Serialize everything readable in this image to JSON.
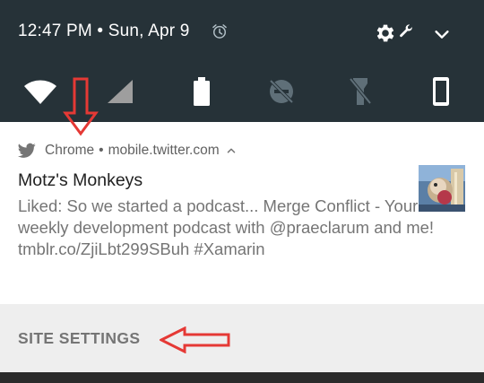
{
  "status_bar": {
    "time": "12:47 PM",
    "separator": "•",
    "date": "Sun, Apr 9",
    "icons": [
      "alarm-icon",
      "settings-gear-icon",
      "wrench-icon",
      "expand-chevron-icon"
    ]
  },
  "quick_settings": {
    "tiles": [
      "wifi-icon",
      "cellular-signal-icon",
      "battery-icon",
      "do-not-disturb-off-icon",
      "flashlight-off-icon",
      "phone-screen-icon"
    ]
  },
  "notification": {
    "app_icon": "twitter-icon",
    "app_name": "Chrome",
    "header_separator": "•",
    "source": "mobile.twitter.com",
    "title": "Motz's Monkeys",
    "body": "Liked: So we started a podcast... Merge Conflict - Your weekly development podcast with @praeclarum and me! tmblr.co/ZjiLbt299SBuh #Xamarin",
    "thumbnail": "avatar-thumbnail"
  },
  "actions": {
    "site_settings": "SITE SETTINGS"
  },
  "colors": {
    "shade": "#263238",
    "card": "#ffffff",
    "action_bar": "#eeeeee",
    "annotation": "#e53935"
  }
}
